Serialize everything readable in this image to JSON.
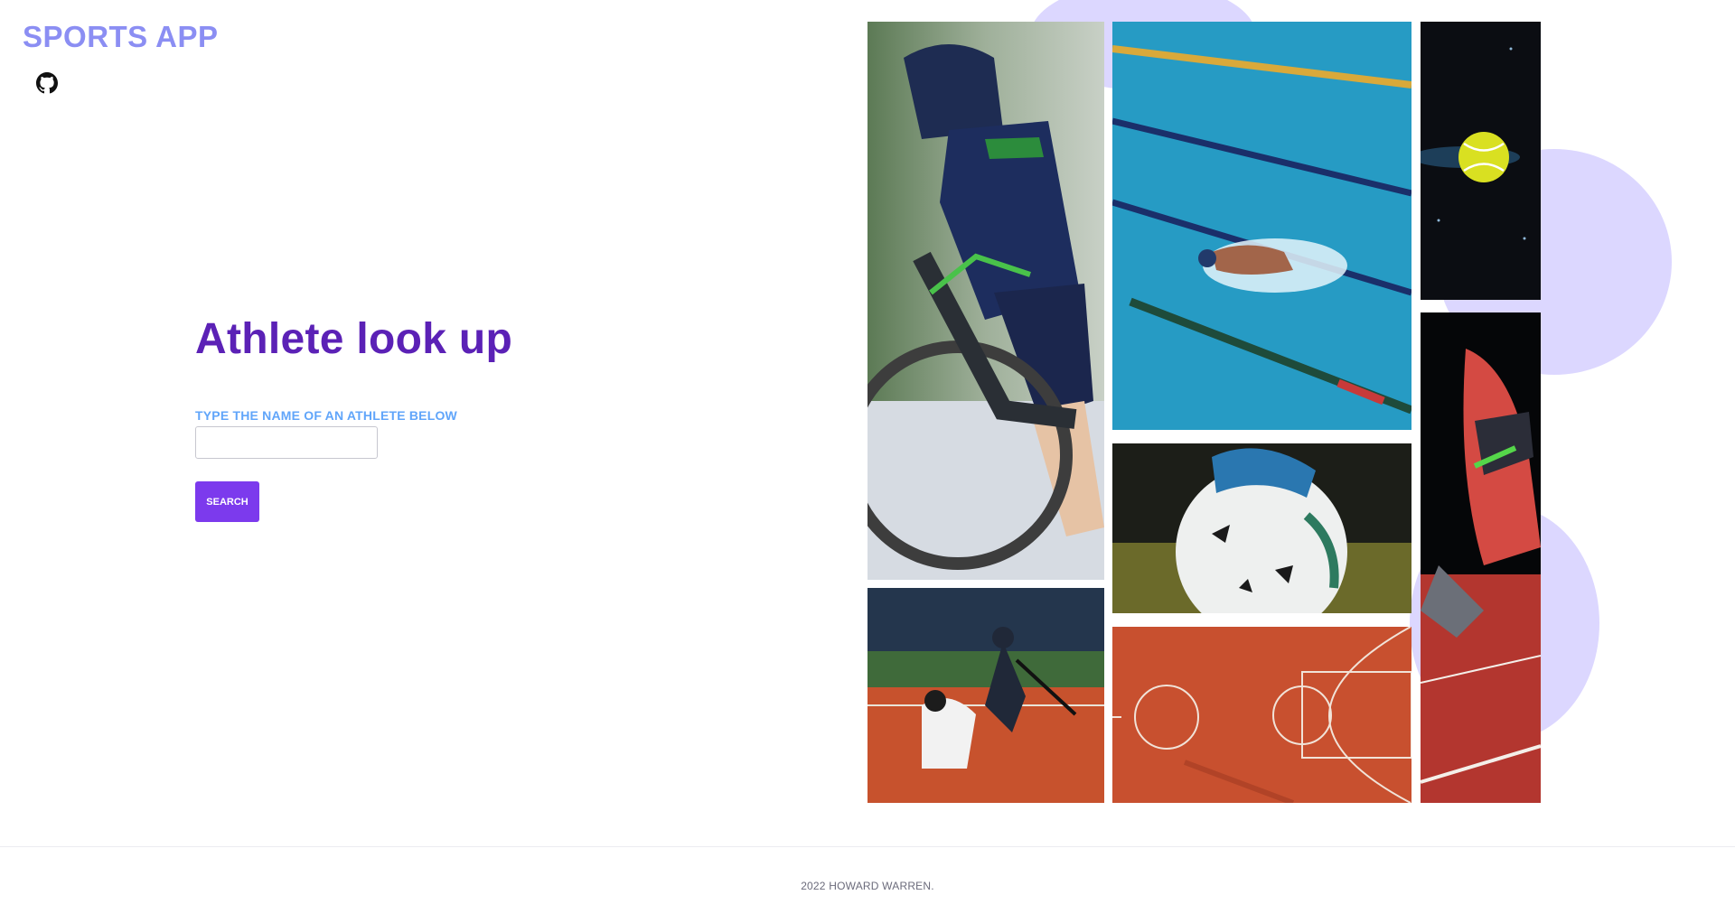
{
  "header": {
    "brand": "SPORTS APP",
    "github_icon": "github-icon"
  },
  "main": {
    "title": "Athlete look up",
    "search_label": "TYPE THE NAME OF AN ATHLETE BELOW",
    "search_value": "",
    "search_placeholder": "",
    "search_button": "SEARCH"
  },
  "gallery": {
    "images": [
      "cyclist",
      "swimmer",
      "tennis-ball",
      "soccer-ball",
      "baseball-batter",
      "basketball-court",
      "sprinter-shoe"
    ]
  },
  "colors": {
    "brand": "#8b8ef3",
    "title": "#5b21b6",
    "label": "#60a5fa",
    "button": "#7c3aed",
    "blob": "#dcd7ff"
  },
  "footer": {
    "copyright": "2022 HOWARD WARREN."
  }
}
